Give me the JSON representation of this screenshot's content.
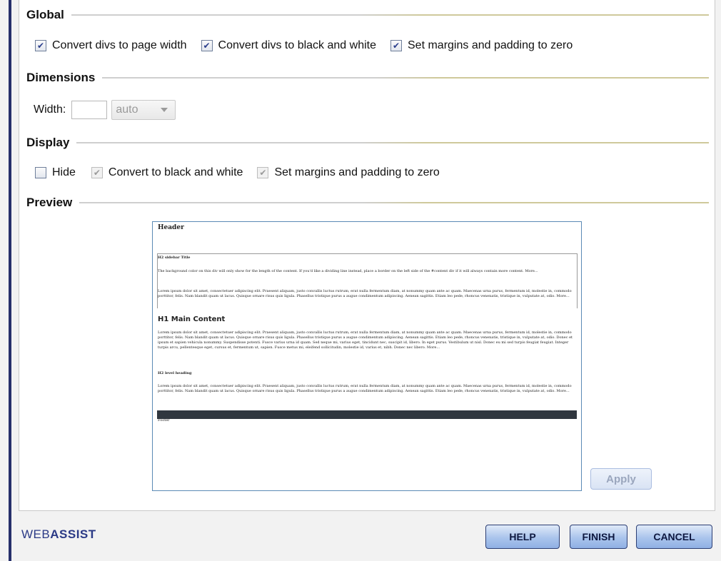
{
  "sections": {
    "global": "Global",
    "dimensions": "Dimensions",
    "display": "Display",
    "preview": "Preview"
  },
  "global": {
    "options": [
      {
        "label": "Convert divs to page width",
        "checked": true
      },
      {
        "label": "Convert divs to black and white",
        "checked": true
      },
      {
        "label": "Set margins and padding to zero",
        "checked": true
      }
    ]
  },
  "dimensions": {
    "width_label": "Width:",
    "width_value": "",
    "unit_selected": "auto"
  },
  "display": {
    "hide_label": "Hide",
    "hide_checked": false,
    "bw_label": "Convert to black and white",
    "bw_checked": true,
    "margins_label": "Set margins and padding to zero",
    "margins_checked": true
  },
  "preview": {
    "header": "Header",
    "sidebar_title": "H2 sidebar Title",
    "sidebar_p1": "The background color on this div will only show for the length of the content. If you'd like a dividing line instead, place a border on the left side of the #content div if it will always contain more content. More...",
    "sidebar_p2": "Lorem ipsum dolor sit amet, consectetuer adipiscing elit. Praesent aliquam, justo convallis luctus rutrum, erat nulla fermentum diam, at nonummy quam ante ac quam. Maecenas urna purus, fermentum id, molestie in, commodo porttitor, felis. Nam blandit quam ut lacus. Quisque ornare risus quis ligula. Phasellus tristique purus a augue condimentum adipiscing. Aenean sagittis. Etiam leo pede, rhoncus venenatis, tristique in, vulputate at, odio. More...",
    "main_title": "H1 Main Content",
    "main_p1": "Lorem ipsum dolor sit amet, consectetuer adipiscing elit. Praesent aliquam, justo convallis luctus rutrum, erat nulla fermentum diam, at nonummy quam ante ac quam. Maecenas urna purus, fermentum id, molestie in, commodo porttitor, felis. Nam blandit quam ut lacus. Quisque ornare risus quis ligula. Phasellus tristique purus a augue condimentum adipiscing. Aenean sagittis. Etiam leo pede, rhoncus venenatis, tristique in, vulputate at, odio. Donec et ipsum et sapien vehicula nonummy. Suspendisse potenti. Fusce varius urna id quam. Sed neque mi, varius eget, tincidunt nec, suscipit id, libero. In eget purus. Vestibulum ut nisl. Donec eu mi sed turpis feugiat feugiat. Integer turpis arcu, pellentesque eget, cursus et, fermentum ut, sapien. Fusce metus mi, eleifend sollicitudin, molestie id, varius et, nibh. Donec nec libero. More...",
    "level2_title": "H2 level heading",
    "main_p2": "Lorem ipsum dolor sit amet, consectetuer adipiscing elit. Praesent aliquam, justo convallis luctus rutrum, erat nulla fermentum diam, at nonummy quam ante ac quam. Maecenas urna purus, fermentum id, molestie in, commodo porttitor, felis. Nam blandit quam ut lacus. Quisque ornare risus quis ligula. Phasellus tristique purus a augue condimentum adipiscing. Aenean sagittis. Etiam leo pede, rhoncus venenatis, tristique in, vulputate at, odio. More...",
    "footer": "Footer"
  },
  "buttons": {
    "apply": "Apply",
    "help": "HELP",
    "finish": "FINISH",
    "cancel": "CANCEL"
  },
  "brand": {
    "part1": "WEB",
    "part2": "ASSIST"
  },
  "colors": {
    "accent": "#27306b",
    "rule_gold": "#cfc99b"
  }
}
